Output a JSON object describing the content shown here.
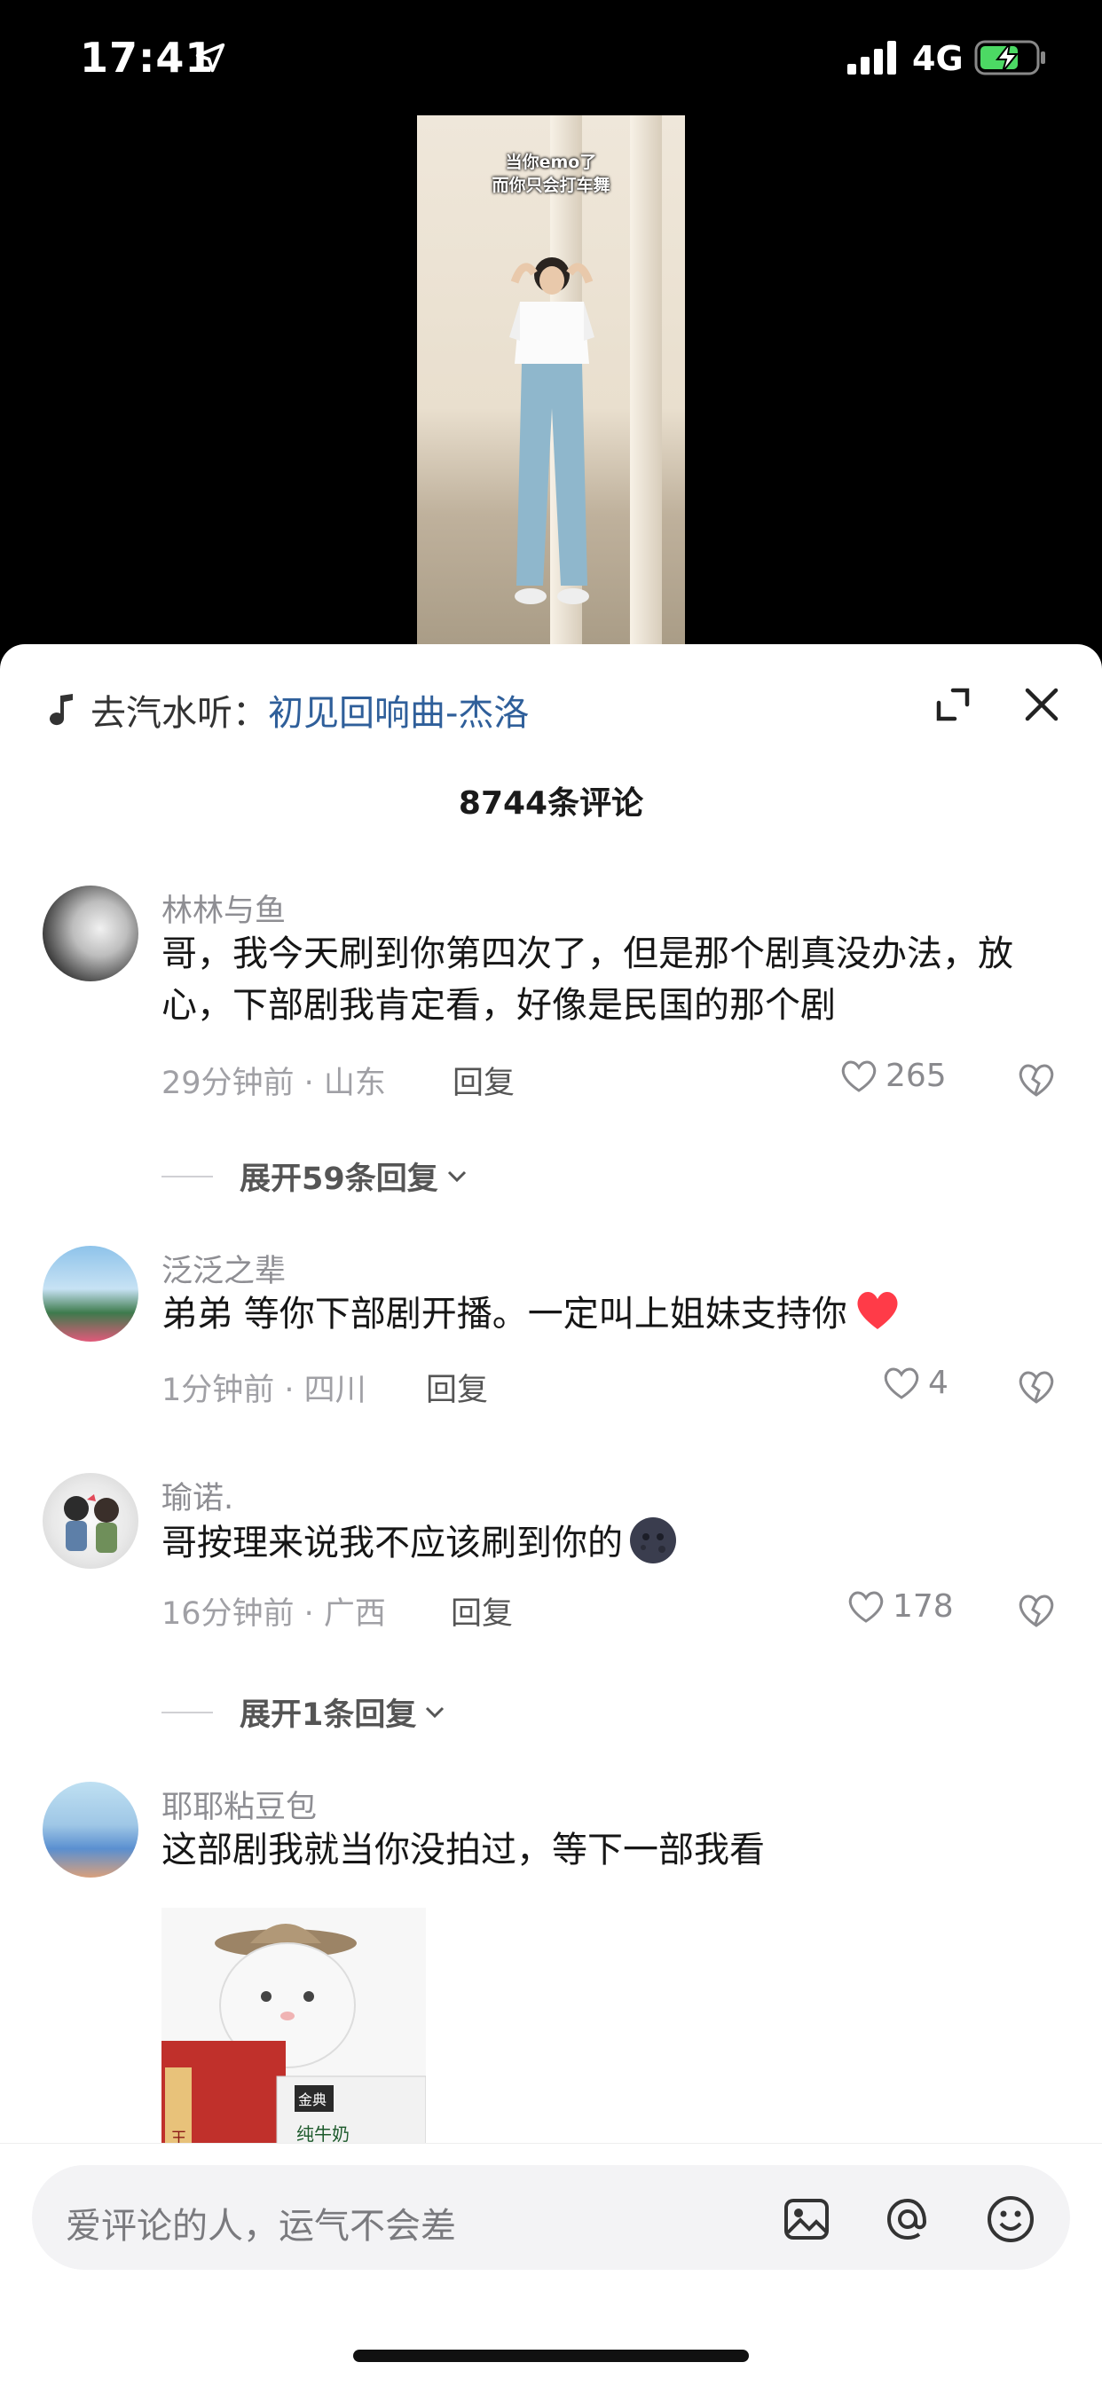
{
  "status_bar": {
    "time": "17:41",
    "network": "4G"
  },
  "video": {
    "caption_line1": "当你emo了",
    "caption_line2": "而你只会打车舞"
  },
  "music": {
    "prefix": "去汽水听：",
    "song": "初见回响曲-杰洛"
  },
  "comments_count": "8744条评论",
  "comments": [
    {
      "user": "林林与鱼",
      "text": "哥，我今天刷到你第四次了，但是那个剧真没办法，放心，下部剧我肯定看，好像是民国的那个剧",
      "meta": "29分钟前 · 山东",
      "reply": "回复",
      "likes": "265",
      "expand": "展开59条回复"
    },
    {
      "user": "泛泛之辈",
      "text": "弟弟 等你下部剧开播。一定叫上姐妹支持你",
      "meta": "1分钟前 · 四川",
      "reply": "回复",
      "likes": "4"
    },
    {
      "user": "瑜诺.",
      "text": "哥按理来说我不应该刷到你的",
      "meta": "16分钟前 · 广西",
      "reply": "回复",
      "likes": "178",
      "expand": "展开1条回复"
    },
    {
      "user": "耶耶粘豆包",
      "text": "这部剧我就当你没拍过，等下一部我看"
    }
  ],
  "sticker": {
    "box_left": "王老吉",
    "box_right_brand": "金典",
    "box_right_label": "纯牛奶"
  },
  "input": {
    "placeholder": "爱评论的人，运气不会差"
  },
  "colors": {
    "song_link": "#2f5f9a",
    "heart_emoji": "#ff3b48"
  }
}
